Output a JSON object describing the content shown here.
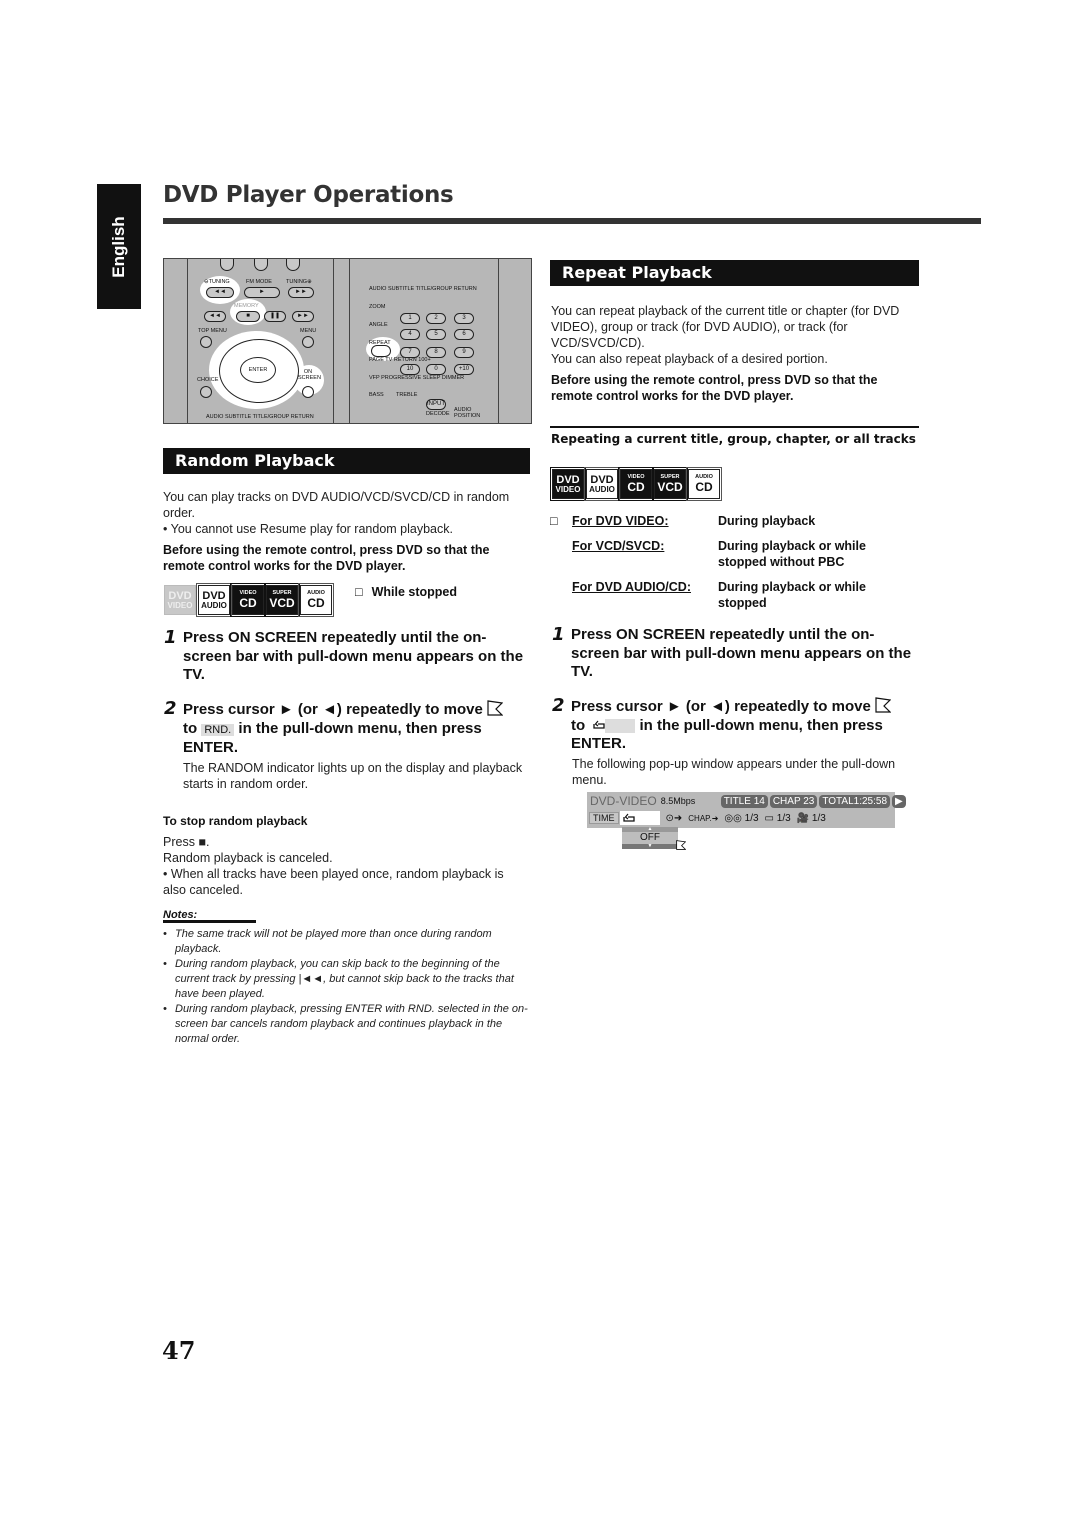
{
  "language_tab": "English",
  "page_title": "DVD Player Operations",
  "remote": {
    "left_labels": {
      "tuning_minus": "⊖TUNING",
      "fm_mode": "FM MODE",
      "tuning_plus": "TUNING⊕",
      "memory": "MEMORY",
      "top_menu": "TOP MENU",
      "menu": "MENU",
      "enter": "ENTER",
      "choice": "CHOICE",
      "on_screen": "ON SCREEN",
      "bottom_row": "AUDIO   SUBTITLE TITLE/GROUP RETURN"
    },
    "right_labels": {
      "row1": "AUDIO  SUBTITLE TITLE/GROUP RETURN",
      "zoom": "ZOOM",
      "angle": "ANGLE",
      "repeat": "REPEAT",
      "page_row": "PAGE  TV RETURN      100+",
      "vfp_row": "VFP  PROGRESSIVE SLEEP  DIMMER",
      "bass": "BASS",
      "treble": "TREBLE",
      "input": "INPUT",
      "decode": "DECODE",
      "audio_position": "AUDIO POSITION",
      "keys": [
        "1",
        "2",
        "3",
        "4",
        "5",
        "6",
        "7",
        "8",
        "9",
        "10",
        "0",
        "+10"
      ]
    }
  },
  "random": {
    "heading": "Random Playback",
    "intro": "You can play tracks on DVD AUDIO/VCD/SVCD/CD in random order.",
    "bullet": "• You cannot use Resume play for random playback.",
    "before_note": "Before using the remote control, press DVD so that the remote control works for the DVD player.",
    "badges": [
      {
        "top": "DVD",
        "bottom": "VIDEO",
        "style": "dim"
      },
      {
        "top": "DVD",
        "bottom": "AUDIO",
        "style": "light"
      },
      {
        "top": "VIDEO",
        "bottom": "CD",
        "style": "dark"
      },
      {
        "top": "SUPER",
        "bottom": "VCD",
        "style": "dark"
      },
      {
        "top": "AUDIO",
        "bottom": "CD",
        "style": "light"
      }
    ],
    "condition": "While stopped",
    "step1_num": "1",
    "step1": "Press ON SCREEN repeatedly until the on-screen bar with pull-down menu appears on the TV.",
    "step2_num": "2",
    "step2_a": "Press cursor ► (or ◄) repeatedly to move",
    "step2_to": "to",
    "step2_chip": "RND.",
    "step2_b": "in the pull-down menu, then press",
    "step2_enter": "ENTER.",
    "step2_desc": "The RANDOM indicator lights up on the display and playback starts in random order.",
    "stop_heading": "To stop random playback",
    "stop_press": "Press ■.",
    "stop_canceled": "Random playback is canceled.",
    "stop_bullet": "• When all tracks have been played once, random playback is also canceled.",
    "notes_heading": "Notes:",
    "notes": [
      "The same track will not be played more than once during random playback.",
      "During random playback, you can skip back to the beginning of the current track by pressing |◄◄, but cannot skip back to the tracks that have been played.",
      "During random playback, pressing ENTER with RND. selected in the on-screen bar cancels random playback and continues playback in the normal order."
    ]
  },
  "repeat": {
    "heading": "Repeat Playback",
    "intro": "You can repeat playback of the current title or chapter (for DVD VIDEO), group or track (for DVD AUDIO), or track (for VCD/SVCD/CD).",
    "intro2": "You can also repeat playback of a desired portion.",
    "before_note": "Before using the remote control, press DVD so that the remote control works for the DVD player.",
    "subheading": "Repeating a current title, group, chapter, or all tracks",
    "badges": [
      {
        "top": "DVD",
        "bottom": "VIDEO",
        "style": "dark"
      },
      {
        "top": "DVD",
        "bottom": "AUDIO",
        "style": "light"
      },
      {
        "top": "VIDEO",
        "bottom": "CD",
        "style": "dark"
      },
      {
        "top": "SUPER",
        "bottom": "VCD",
        "style": "dark"
      },
      {
        "top": "AUDIO",
        "bottom": "CD",
        "style": "light"
      }
    ],
    "conditions": [
      {
        "label": "For DVD VIDEO:",
        "value": "During playback"
      },
      {
        "label": "For VCD/SVCD:",
        "value": "During playback or while stopped without PBC"
      },
      {
        "label": "For DVD AUDIO/CD:",
        "value": "During playback or while stopped"
      }
    ],
    "step1_num": "1",
    "step1": "Press ON SCREEN repeatedly until the on-screen bar with pull-down menu appears on the TV.",
    "step2_num": "2",
    "step2_a": "Press cursor ► (or ◄) repeatedly to move",
    "step2_to": "to",
    "step2_chip_icon": "repeat-icon",
    "step2_b": "in the pull-down menu, then press",
    "step2_enter": "ENTER.",
    "step2_desc": "The following pop-up window appears under the pull-down menu.",
    "osd": {
      "disc_type": "DVD-VIDEO",
      "bitrate": "8.5Mbps",
      "title": "TITLE 14",
      "chapter": "CHAP 23",
      "total": "TOTAL1:25:58",
      "time_label": "TIME",
      "chap_label": "CHAP.",
      "audio_value": "1/3",
      "subtitle_value": "1/3",
      "angle_value": "1/3",
      "dropdown_value": "OFF"
    }
  },
  "page_number": "47"
}
